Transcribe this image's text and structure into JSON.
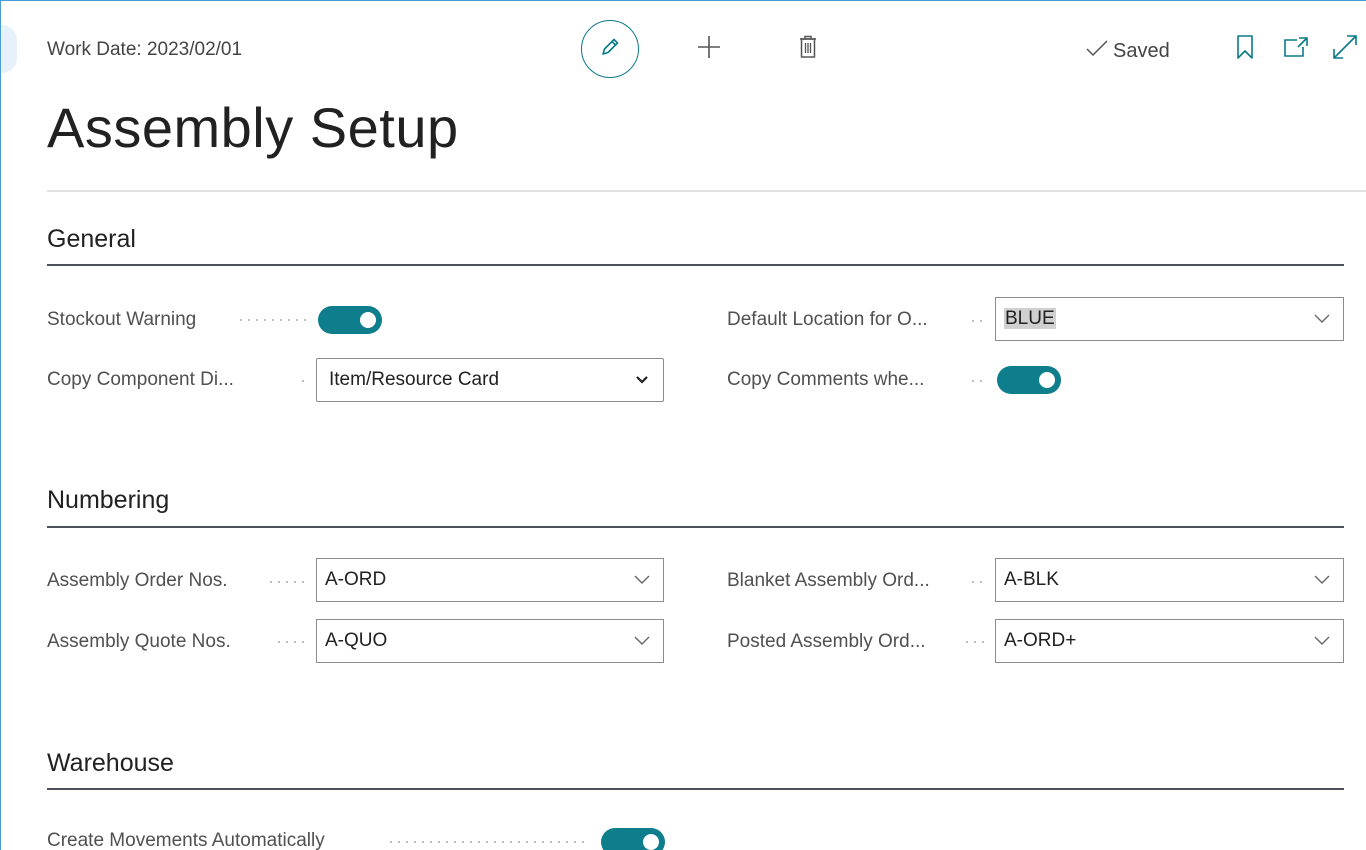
{
  "header": {
    "work_date": "Work Date: 2023/02/01",
    "saved_label": "Saved",
    "icons": [
      "pencil-icon",
      "plus-icon",
      "trash-icon",
      "checkmark-icon",
      "bookmark-icon",
      "open-in-new-window-icon",
      "expand-icon"
    ]
  },
  "page": {
    "title": "Assembly Setup"
  },
  "colors": {
    "accent": "#0e7d8c",
    "section_rule": "#4c5057",
    "window_border": "#4a9bd8"
  },
  "general": {
    "title": "General",
    "stockout_warning_label": "Stockout Warning",
    "stockout_warning_on": true,
    "copy_component_label": "Copy Component Di...",
    "copy_component_value": "Item/Resource Card",
    "default_location_label": "Default Location for O...",
    "default_location_value": "BLUE",
    "copy_comments_label": "Copy Comments whe...",
    "copy_comments_on": true
  },
  "numbering": {
    "title": "Numbering",
    "assembly_order_nos_label": "Assembly Order Nos.",
    "assembly_order_nos_value": "A-ORD",
    "assembly_quote_nos_label": "Assembly Quote Nos.",
    "assembly_quote_nos_value": "A-QUO",
    "blanket_assembly_label": "Blanket Assembly Ord...",
    "blanket_assembly_value": "A-BLK",
    "posted_assembly_label": "Posted Assembly Ord...",
    "posted_assembly_value": "A-ORD+"
  },
  "warehouse": {
    "title": "Warehouse",
    "create_movements_label": "Create Movements Automatically",
    "create_movements_on": true
  }
}
